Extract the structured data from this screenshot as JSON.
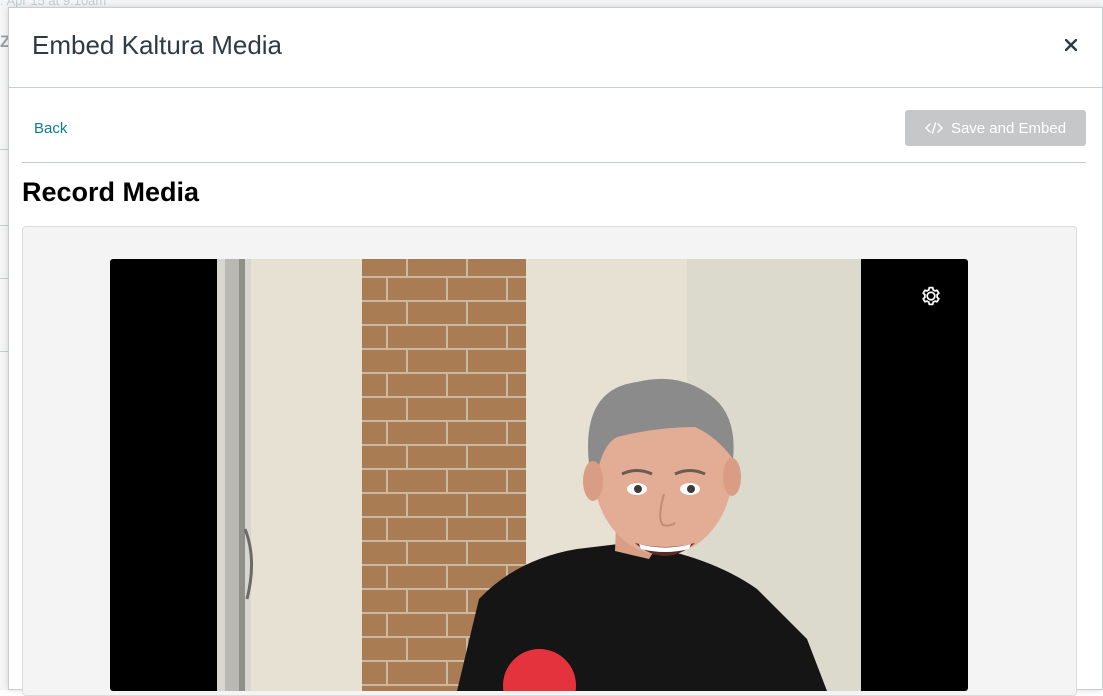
{
  "background": {
    "top_text": ": Apr 15 at 9:10am",
    "edge_letter": "Z"
  },
  "modal": {
    "title": "Embed Kaltura Media",
    "close_icon": "close-icon",
    "close_glyph": "×"
  },
  "toolbar": {
    "back_label": "Back",
    "save_label": "Save and Embed",
    "save_icon": "code-icon",
    "save_disabled": true
  },
  "section": {
    "title": "Record Media"
  },
  "recorder": {
    "settings_icon": "gear-icon",
    "record_icon": "record-icon",
    "colors": {
      "record": "#e5333d",
      "accent_link": "#0a7e8c",
      "disabled_button": "#c5c7c9"
    }
  }
}
